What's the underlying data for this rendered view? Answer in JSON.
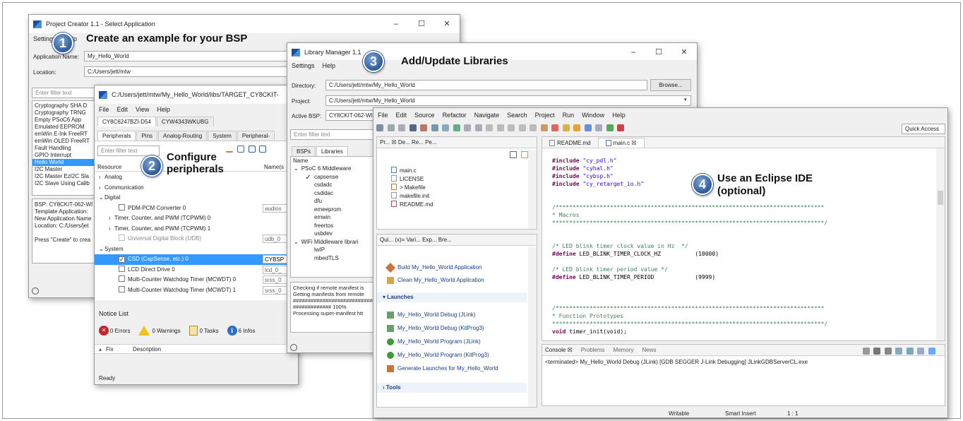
{
  "callouts": {
    "step1": {
      "num": "1",
      "text": "Create an example for your BSP"
    },
    "step2": {
      "num": "2",
      "text": "Configure\nperipherals"
    },
    "step3": {
      "num": "3",
      "text": "Add/Update Libraries"
    },
    "step4": {
      "num": "4",
      "text": "Use an Eclipse IDE\n(optional)"
    }
  },
  "window_controls": {
    "minimize": "–",
    "maximize": "☐",
    "close": "✕"
  },
  "project_creator": {
    "title": "Project Creator 1.1 - Select Application",
    "menu": [
      "Settings",
      "Help"
    ],
    "app_name_label": "Application Name:",
    "app_name_value": "My_Hello_World",
    "location_label": "Location:",
    "location_value": "C:/Users/jett/mtw",
    "filter_placeholder": "Enter filter text",
    "apps": [
      "Cryptography SHA D",
      "Cryptography TRNG",
      "Empty PSoC6 App",
      "Emulated EEPROM",
      "emWin E-Ink FreeRT",
      "emWin OLED FreeRT",
      "Fault Handling",
      "GPIO Interrupt",
      "Hello World",
      "I2C Master",
      "I2C Master EzI2C Sla",
      "I2C Slave Using Callb"
    ],
    "info": [
      "BSP: CY8CKIT-062-WI",
      "Template Application:",
      "New Application Name",
      "Location: C:/Users/jet",
      "",
      "Press \"Create\" to crea"
    ]
  },
  "device_configurator": {
    "title": "C:/Users/jett/mtw/My_Hello_World/libs/TARGET_CY8CKIT-",
    "menu": [
      "File",
      "Edit",
      "View",
      "Help"
    ],
    "device_tabs": [
      "CY8C6247BZI-D54",
      "CYW4343WKUBG"
    ],
    "tabs": [
      "Peripherals",
      "Pins",
      "Analog-Routing",
      "System",
      "Peripheral-"
    ],
    "filter_placeholder": "Enter filter text",
    "col_resource": "Resource",
    "col_name": "Name(s",
    "resources": [
      {
        "label": "Analog",
        "indent": 0,
        "arrow": "›"
      },
      {
        "label": "Communication",
        "indent": 0,
        "arrow": "›"
      },
      {
        "label": "Digital",
        "indent": 0,
        "arrow": "⌄"
      },
      {
        "label": "PDM-PCM Converter 0",
        "indent": 2,
        "name": "audios",
        "check": "empty"
      },
      {
        "label": "Timer, Counter, and PWM (TCPWM) 0",
        "indent": 1,
        "arrow": "›"
      },
      {
        "label": "Timer, Counter, and PWM (TCPWM) 1",
        "indent": 1,
        "arrow": "›"
      },
      {
        "label": "Universal Digital Block (UDB)",
        "indent": 2,
        "name": "udb_0",
        "check": "lock"
      },
      {
        "label": "System",
        "indent": 0,
        "arrow": "⌄"
      },
      {
        "label": "CSD (CapSense, etc.) 0",
        "indent": 2,
        "name": "CYBSP",
        "check": "checked",
        "selected": true
      },
      {
        "label": "LCD Direct Drive 0",
        "indent": 2,
        "name": "lcd_0_",
        "check": "empty"
      },
      {
        "label": "Multi-Counter Watchdog Timer (MCWDT) 0",
        "indent": 2,
        "name": "srss_0",
        "check": "empty"
      },
      {
        "label": "Multi-Counter Watchdog Timer (MCWDT) 1",
        "indent": 2,
        "name": "srss_0",
        "check": "empty"
      }
    ],
    "notice_title": "Notice List",
    "errors": "0 Errors",
    "warnings": "0 Warnings",
    "tasks": "0 Tasks",
    "infos": "6 Infos",
    "col_fix": "Fix",
    "col_desc": "Description",
    "status": "Ready"
  },
  "library_manager": {
    "title": "Library Manager 1.1",
    "menu": [
      "Settings",
      "Help"
    ],
    "directory_label": "Directory:",
    "directory_value": "C:/Users/jett/mtw/My_Hello_World",
    "browse": "Browse...",
    "project_label": "Project:",
    "project_value": "C:/Users/jett/mtw/My_Hello_World",
    "bsp_label": "Active BSP:",
    "bsp_value": "CY8CKIT-062-WI",
    "filter_placeholder": "Enter filter text",
    "tabs": [
      "BSPs",
      "Libraries"
    ],
    "col_name": "Name",
    "tree": [
      {
        "label": "PSoC 6 Middleware",
        "indent": 0,
        "group": true
      },
      {
        "label": "capsense",
        "indent": 1,
        "checked": true
      },
      {
        "label": "csdadc",
        "indent": 1
      },
      {
        "label": "csdidac",
        "indent": 1
      },
      {
        "label": "dfu",
        "indent": 1
      },
      {
        "label": "emeeprom",
        "indent": 1
      },
      {
        "label": "emwin",
        "indent": 1
      },
      {
        "label": "freertos",
        "indent": 1
      },
      {
        "label": "usbdev",
        "indent": 1
      },
      {
        "label": "WiFi Middleware librari",
        "indent": 0,
        "group": true
      },
      {
        "label": "lwIP",
        "indent": 1
      },
      {
        "label": "mbedTLS",
        "indent": 1
      }
    ],
    "log": [
      "Checking if remote manifest is",
      "Getting manifests from remote",
      "################################",
      "############# 100%",
      "Processing super-manifest htt"
    ]
  },
  "eclipse": {
    "menu": [
      "File",
      "Edit",
      "Source",
      "Refactor",
      "Navigate",
      "Search",
      "Project",
      "Run",
      "Window",
      "Help"
    ],
    "quick_access": "Quick Access",
    "explorer_tabs": "Pr... ☒  De...  Re...  Pe...",
    "files": [
      {
        "label": "main.c",
        "kind": "c"
      },
      {
        "label": "LICENSE",
        "kind": "txt"
      },
      {
        "label": "> Makefile",
        "kind": "mk"
      },
      {
        "label": "makefile.init",
        "kind": "txt"
      },
      {
        "label": "README.md",
        "kind": "md"
      }
    ],
    "quick_tabs": "Qui...  (x)= Vari...  Exp...  Bre...",
    "actions": [
      "Build My_Hello_World Application",
      "Clean My_Hello_World Application"
    ],
    "launches_header": "Launches",
    "launches": [
      "My_Hello_World Debug (JLink)",
      "My_Hello_World Debug (KitProg3)",
      "My_Hello_World Program (JLink)",
      "My_Hello_World Program (KitProg3)",
      "Generate Launches for My_Hello_World"
    ],
    "tools_header": "Tools",
    "editor_tabs": [
      "README.md",
      "main.c ☒"
    ],
    "code": [
      {
        "t": "inc",
        "a": "#include ",
        "b": "\"cy_pdl.h\""
      },
      {
        "t": "inc",
        "a": "#include ",
        "b": "\"cyhal.h\""
      },
      {
        "t": "inc",
        "a": "#include ",
        "b": "\"cybsp.h\""
      },
      {
        "t": "inc",
        "a": "#include ",
        "b": "\"cy_retarget_io.h\""
      },
      {
        "t": "blank"
      },
      {
        "t": "blank"
      },
      {
        "t": "cmt",
        "a": "/*******************************************************************************"
      },
      {
        "t": "cmt",
        "a": "* Macros"
      },
      {
        "t": "cmt",
        "a": "********************************************************************************/"
      },
      {
        "t": "blank"
      },
      {
        "t": "blank"
      },
      {
        "t": "cmt",
        "a": "/* LED blink timer clock value in Hz  */"
      },
      {
        "t": "def",
        "a": "#define ",
        "b": "LED_BLINK_TIMER_CLOCK_HZ          (10000)"
      },
      {
        "t": "blank"
      },
      {
        "t": "cmt",
        "a": "/* LED blink timer period value */"
      },
      {
        "t": "def",
        "a": "#define ",
        "b": "LED_BLINK_TIMER_PERIOD            (9999)"
      },
      {
        "t": "blank"
      },
      {
        "t": "blank"
      },
      {
        "t": "blank"
      },
      {
        "t": "cmt",
        "a": "/*******************************************************************************"
      },
      {
        "t": "cmt",
        "a": "* Function Prototypes"
      },
      {
        "t": "cmt",
        "a": "********************************************************************************/"
      },
      {
        "t": "proto",
        "a": "void ",
        "b": "timer_init(void);"
      }
    ],
    "console_tabs": [
      "Console ☒",
      "Problems",
      "Memory",
      "News"
    ],
    "console_text": "<terminated> My_Hello_World Debug (JLink) [GDB SEGGER J-Link Debugging] JLinkGDBServerCL.exe",
    "status": [
      "Writable",
      "Smart Insert",
      "1 : 1"
    ]
  }
}
